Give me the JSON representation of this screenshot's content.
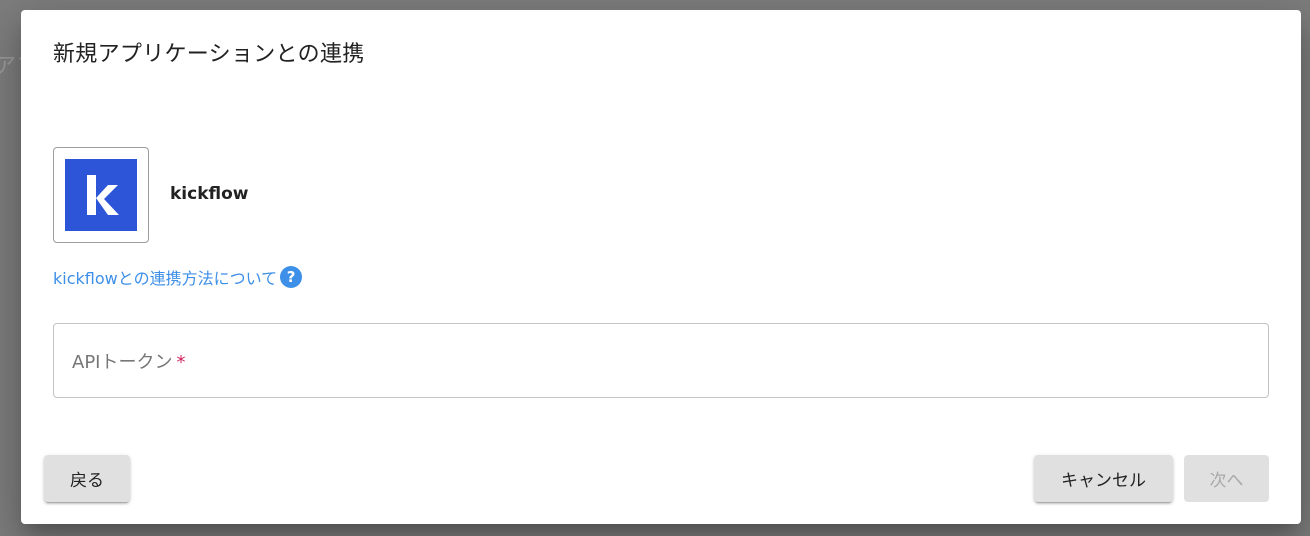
{
  "background": {
    "fragment_text": "アプ"
  },
  "dialog": {
    "title": "新規アプリケーションとの連携",
    "app": {
      "name": "kickflow",
      "logo_letter": "k",
      "logo_color": "#2d55d8"
    },
    "help_link": {
      "label": "kickflowとの連携方法について",
      "icon": "question-circle-icon",
      "icon_glyph": "?"
    },
    "api_token_field": {
      "label": "APIトークン",
      "required_mark": "*",
      "value": ""
    },
    "buttons": {
      "back": "戻る",
      "cancel": "キャンセル",
      "next": "次へ"
    }
  },
  "colors": {
    "link": "#3d8fe8",
    "required": "#d0245e",
    "button_bg": "#e0e0e0",
    "disabled_text": "#a9a9a9"
  }
}
